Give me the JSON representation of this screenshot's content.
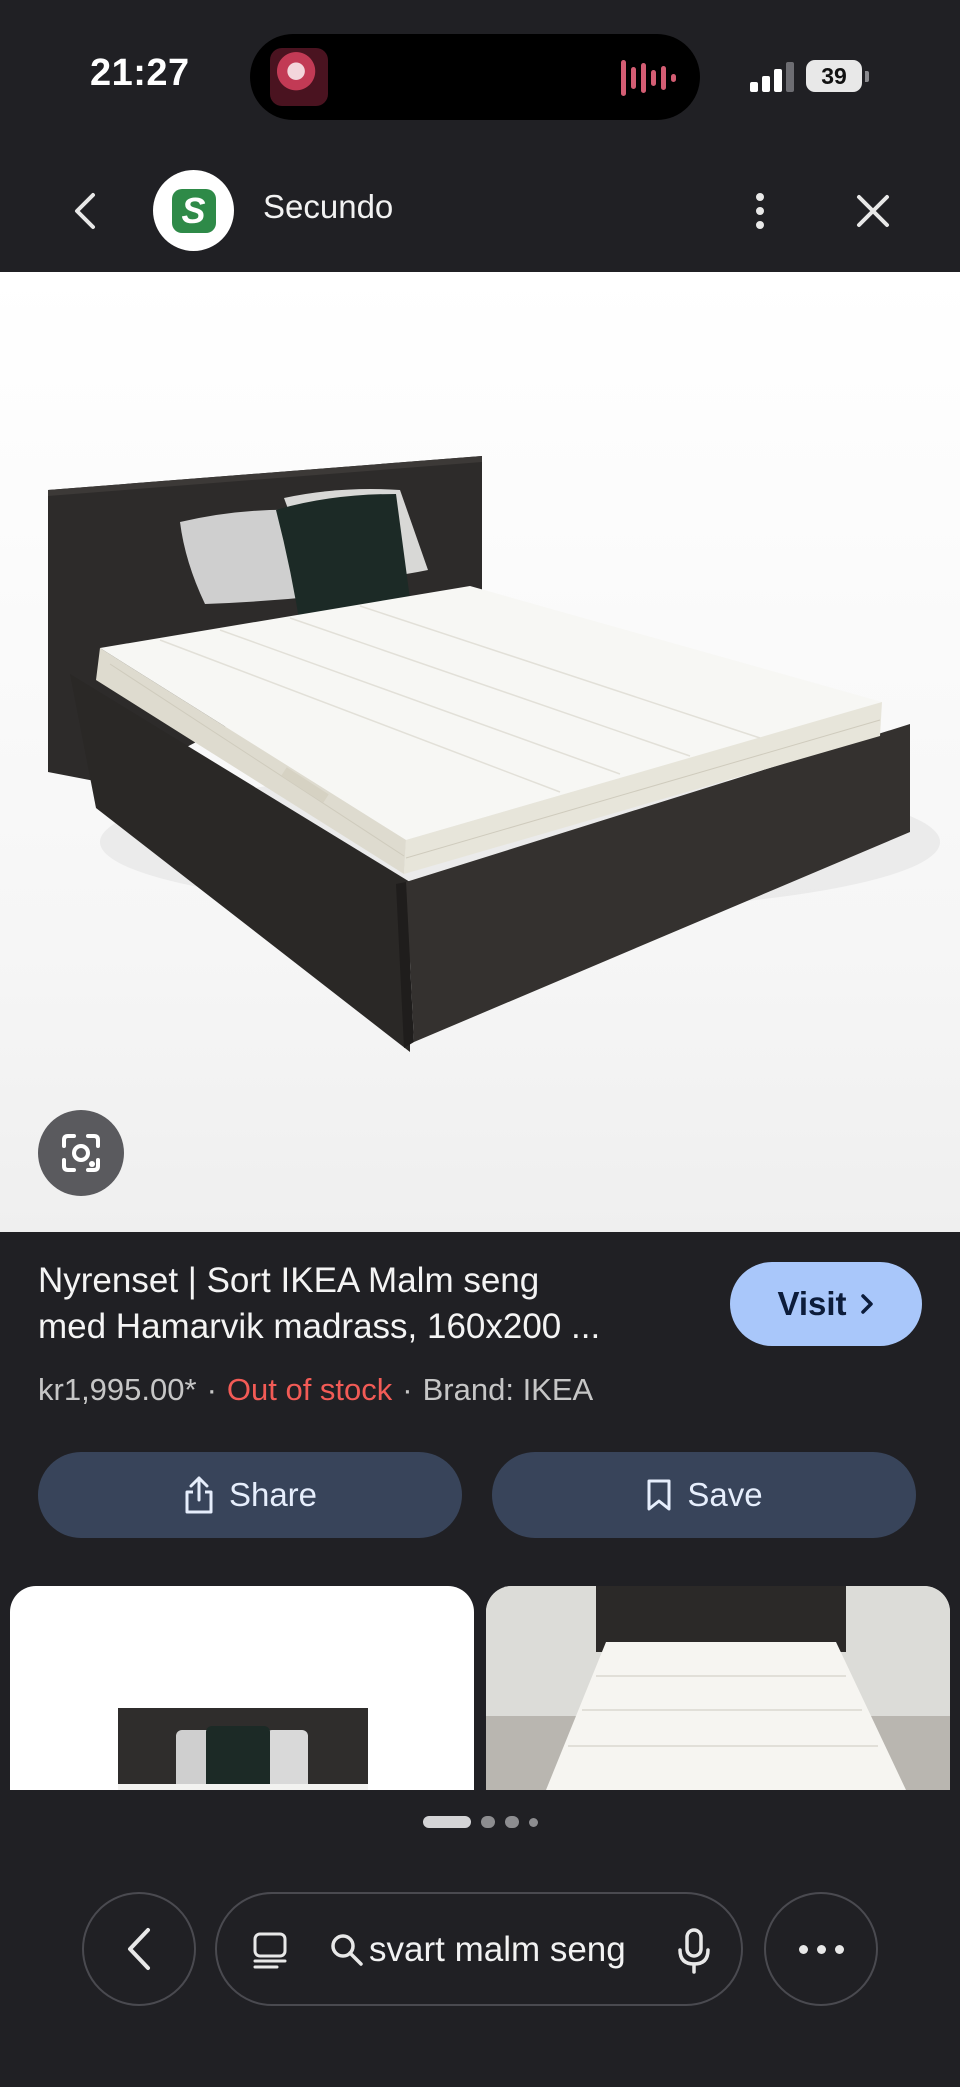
{
  "status_bar": {
    "time": "21:27",
    "battery": "39"
  },
  "header": {
    "logo_letter": "S",
    "site_name": "Secundo"
  },
  "product": {
    "title_line1": "Nyrenset | Sort IKEA Malm seng",
    "title_line2": "med Hamarvik madrass, 160x200 ...",
    "price": "kr1,995.00*",
    "stock": "Out of stock",
    "brand": "Brand: IKEA",
    "visit_label": "Visit"
  },
  "actions": {
    "share_label": "Share",
    "save_label": "Save"
  },
  "pager": {
    "current": 1,
    "total": 4
  },
  "search_bar": {
    "query": "svart malm seng"
  },
  "colors": {
    "background": "#202024",
    "visit_button": "#a9c7fa",
    "action_button": "#38445a",
    "out_of_stock": "#f25b56",
    "logo_green": "#2e8a48"
  },
  "icons": {
    "back": "chevron-left-icon",
    "menu": "kebab-menu-icon",
    "close": "close-icon",
    "lens": "google-lens-icon",
    "share": "share-icon",
    "save": "bookmark-icon",
    "tabs": "tabs-icon",
    "search": "search-icon",
    "mic": "mic-icon",
    "more": "more-horizontal-icon"
  }
}
